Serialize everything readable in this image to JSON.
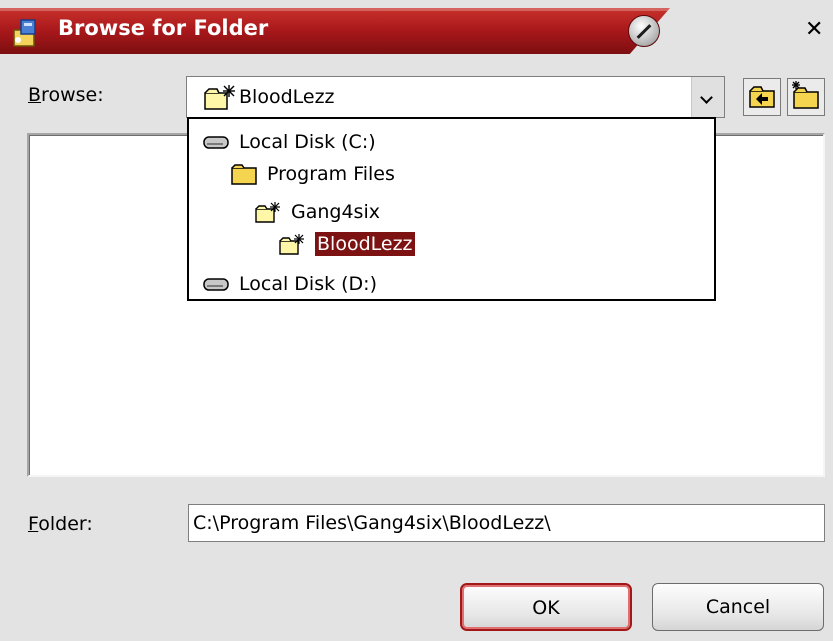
{
  "window": {
    "title": "Browse for Folder",
    "accent_color": "#a8171a"
  },
  "browse": {
    "label_hotkey": "B",
    "label_rest": "rowse:",
    "selected": "BloodLezz",
    "selected_icon": "special-folder-icon"
  },
  "dropdown": {
    "items": [
      {
        "label": "Local Disk (C:)",
        "icon": "drive-icon",
        "level": 0,
        "selected": false
      },
      {
        "label": "Program Files",
        "icon": "folder-icon",
        "level": 1,
        "selected": false
      },
      {
        "label": "Gang4six",
        "icon": "special-folder-icon",
        "level": 2,
        "selected": false
      },
      {
        "label": "BloodLezz",
        "icon": "special-folder-icon",
        "level": 3,
        "selected": true
      },
      {
        "label": "Local Disk (D:)",
        "icon": "drive-icon",
        "level": 0,
        "selected": false
      }
    ]
  },
  "folder": {
    "label_hotkey": "F",
    "label_rest": "older:",
    "value": "C:\\Program Files\\Gang4six\\BloodLezz\\"
  },
  "buttons": {
    "ok": "OK",
    "cancel": "Cancel"
  }
}
